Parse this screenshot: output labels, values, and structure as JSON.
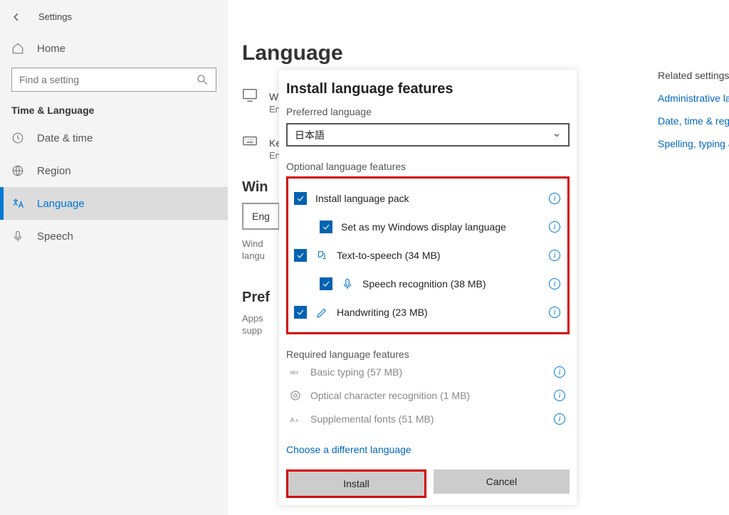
{
  "header": {
    "title": "Settings"
  },
  "sidebar": {
    "home": "Home",
    "search_placeholder": "Find a setting",
    "group": "Time & Language",
    "items": [
      {
        "label": "Date & time"
      },
      {
        "label": "Region"
      },
      {
        "label": "Language"
      },
      {
        "label": "Speech"
      }
    ]
  },
  "page": {
    "title": "Language",
    "wdl_label": "Wi",
    "wdl_sub": "Eng",
    "key_label": "Key",
    "key_sub": "Eng",
    "win_header": "Win",
    "eng_btn": "Eng",
    "wind_line": "Wind",
    "langu_line": "langu",
    "pref_header": "Pref",
    "apps_line": "Apps",
    "supp_line": "supp"
  },
  "related": {
    "heading": "Related settings",
    "links": [
      "Administrative language settings",
      "Date, time & regional formatting",
      "Spelling, typing & keyboard settings"
    ]
  },
  "dialog": {
    "title": "Install language features",
    "pref_label": "Preferred language",
    "selected_language": "日本語",
    "optional_label": "Optional language features",
    "features": [
      {
        "label": "Install language pack"
      },
      {
        "label": "Set as my Windows display language"
      },
      {
        "label": "Text-to-speech (34 MB)"
      },
      {
        "label": "Speech recognition (38 MB)"
      },
      {
        "label": "Handwriting (23 MB)"
      }
    ],
    "required_label": "Required language features",
    "required": [
      {
        "label": "Basic typing (57 MB)"
      },
      {
        "label": "Optical character recognition (1 MB)"
      },
      {
        "label": "Supplemental fonts (51 MB)"
      }
    ],
    "diff_link": "Choose a different language",
    "install": "Install",
    "cancel": "Cancel"
  }
}
